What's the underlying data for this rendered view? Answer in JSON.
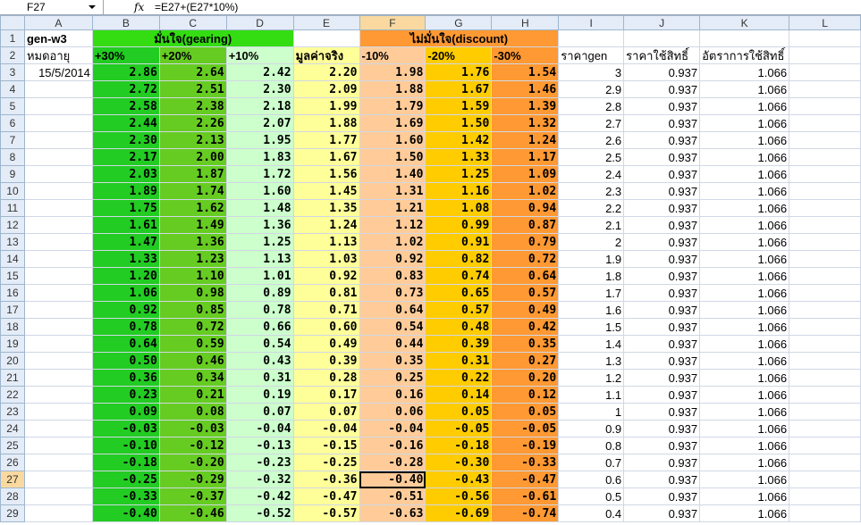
{
  "name_box": "F27",
  "formula": "=E27+(E27*10%)",
  "columns": [
    "A",
    "B",
    "C",
    "D",
    "E",
    "F",
    "G",
    "H",
    "I",
    "J",
    "K",
    "L"
  ],
  "row1": {
    "A": "gen-w3",
    "BD": "มั่นใจ(gearing)",
    "FH": "ไม่มั่นใจ(discount)"
  },
  "row2": {
    "A": "หมดอายุ",
    "B": "+30%",
    "C": "+20%",
    "D": "+10%",
    "E": "มูลค่าจริง",
    "F": "-10%",
    "G": "-20%",
    "H": "-30%",
    "I": "ราคาgen",
    "J": "ราคาใช้สิทธิ์",
    "K": "อัตราการใช้สิทธิ์"
  },
  "date": "15/5/2014",
  "rows": [
    {
      "r": "3",
      "B": "2.86",
      "C": "2.64",
      "D": "2.42",
      "E": "2.20",
      "F": "1.98",
      "G": "1.76",
      "H": "1.54",
      "I": "3",
      "J": "0.937",
      "K": "1.066"
    },
    {
      "r": "4",
      "B": "2.72",
      "C": "2.51",
      "D": "2.30",
      "E": "2.09",
      "F": "1.88",
      "G": "1.67",
      "H": "1.46",
      "I": "2.9",
      "J": "0.937",
      "K": "1.066"
    },
    {
      "r": "5",
      "B": "2.58",
      "C": "2.38",
      "D": "2.18",
      "E": "1.99",
      "F": "1.79",
      "G": "1.59",
      "H": "1.39",
      "I": "2.8",
      "J": "0.937",
      "K": "1.066"
    },
    {
      "r": "6",
      "B": "2.44",
      "C": "2.26",
      "D": "2.07",
      "E": "1.88",
      "F": "1.69",
      "G": "1.50",
      "H": "1.32",
      "I": "2.7",
      "J": "0.937",
      "K": "1.066"
    },
    {
      "r": "7",
      "B": "2.30",
      "C": "2.13",
      "D": "1.95",
      "E": "1.77",
      "F": "1.60",
      "G": "1.42",
      "H": "1.24",
      "I": "2.6",
      "J": "0.937",
      "K": "1.066"
    },
    {
      "r": "8",
      "B": "2.17",
      "C": "2.00",
      "D": "1.83",
      "E": "1.67",
      "F": "1.50",
      "G": "1.33",
      "H": "1.17",
      "I": "2.5",
      "J": "0.937",
      "K": "1.066"
    },
    {
      "r": "9",
      "B": "2.03",
      "C": "1.87",
      "D": "1.72",
      "E": "1.56",
      "F": "1.40",
      "G": "1.25",
      "H": "1.09",
      "I": "2.4",
      "J": "0.937",
      "K": "1.066"
    },
    {
      "r": "10",
      "B": "1.89",
      "C": "1.74",
      "D": "1.60",
      "E": "1.45",
      "F": "1.31",
      "G": "1.16",
      "H": "1.02",
      "I": "2.3",
      "J": "0.937",
      "K": "1.066"
    },
    {
      "r": "11",
      "B": "1.75",
      "C": "1.62",
      "D": "1.48",
      "E": "1.35",
      "F": "1.21",
      "G": "1.08",
      "H": "0.94",
      "I": "2.2",
      "J": "0.937",
      "K": "1.066"
    },
    {
      "r": "12",
      "B": "1.61",
      "C": "1.49",
      "D": "1.36",
      "E": "1.24",
      "F": "1.12",
      "G": "0.99",
      "H": "0.87",
      "I": "2.1",
      "J": "0.937",
      "K": "1.066"
    },
    {
      "r": "13",
      "B": "1.47",
      "C": "1.36",
      "D": "1.25",
      "E": "1.13",
      "F": "1.02",
      "G": "0.91",
      "H": "0.79",
      "I": "2",
      "J": "0.937",
      "K": "1.066"
    },
    {
      "r": "14",
      "B": "1.33",
      "C": "1.23",
      "D": "1.13",
      "E": "1.03",
      "F": "0.92",
      "G": "0.82",
      "H": "0.72",
      "I": "1.9",
      "J": "0.937",
      "K": "1.066"
    },
    {
      "r": "15",
      "B": "1.20",
      "C": "1.10",
      "D": "1.01",
      "E": "0.92",
      "F": "0.83",
      "G": "0.74",
      "H": "0.64",
      "I": "1.8",
      "J": "0.937",
      "K": "1.066"
    },
    {
      "r": "16",
      "B": "1.06",
      "C": "0.98",
      "D": "0.89",
      "E": "0.81",
      "F": "0.73",
      "G": "0.65",
      "H": "0.57",
      "I": "1.7",
      "J": "0.937",
      "K": "1.066"
    },
    {
      "r": "17",
      "B": "0.92",
      "C": "0.85",
      "D": "0.78",
      "E": "0.71",
      "F": "0.64",
      "G": "0.57",
      "H": "0.49",
      "I": "1.6",
      "J": "0.937",
      "K": "1.066"
    },
    {
      "r": "18",
      "B": "0.78",
      "C": "0.72",
      "D": "0.66",
      "E": "0.60",
      "F": "0.54",
      "G": "0.48",
      "H": "0.42",
      "I": "1.5",
      "J": "0.937",
      "K": "1.066"
    },
    {
      "r": "19",
      "B": "0.64",
      "C": "0.59",
      "D": "0.54",
      "E": "0.49",
      "F": "0.44",
      "G": "0.39",
      "H": "0.35",
      "I": "1.4",
      "J": "0.937",
      "K": "1.066"
    },
    {
      "r": "20",
      "B": "0.50",
      "C": "0.46",
      "D": "0.43",
      "E": "0.39",
      "F": "0.35",
      "G": "0.31",
      "H": "0.27",
      "I": "1.3",
      "J": "0.937",
      "K": "1.066"
    },
    {
      "r": "21",
      "B": "0.36",
      "C": "0.34",
      "D": "0.31",
      "E": "0.28",
      "F": "0.25",
      "G": "0.22",
      "H": "0.20",
      "I": "1.2",
      "J": "0.937",
      "K": "1.066"
    },
    {
      "r": "22",
      "B": "0.23",
      "C": "0.21",
      "D": "0.19",
      "E": "0.17",
      "F": "0.16",
      "G": "0.14",
      "H": "0.12",
      "I": "1.1",
      "J": "0.937",
      "K": "1.066"
    },
    {
      "r": "23",
      "B": "0.09",
      "C": "0.08",
      "D": "0.07",
      "E": "0.07",
      "F": "0.06",
      "G": "0.05",
      "H": "0.05",
      "I": "1",
      "J": "0.937",
      "K": "1.066"
    },
    {
      "r": "24",
      "B": "-0.03",
      "C": "-0.03",
      "D": "-0.04",
      "E": "-0.04",
      "F": "-0.04",
      "G": "-0.05",
      "H": "-0.05",
      "I": "0.9",
      "J": "0.937",
      "K": "1.066"
    },
    {
      "r": "25",
      "B": "-0.10",
      "C": "-0.12",
      "D": "-0.13",
      "E": "-0.15",
      "F": "-0.16",
      "G": "-0.18",
      "H": "-0.19",
      "I": "0.8",
      "J": "0.937",
      "K": "1.066"
    },
    {
      "r": "26",
      "B": "-0.18",
      "C": "-0.20",
      "D": "-0.23",
      "E": "-0.25",
      "F": "-0.28",
      "G": "-0.30",
      "H": "-0.33",
      "I": "0.7",
      "J": "0.937",
      "K": "1.066"
    },
    {
      "r": "27",
      "B": "-0.25",
      "C": "-0.29",
      "D": "-0.32",
      "E": "-0.36",
      "F": "-0.40",
      "G": "-0.43",
      "H": "-0.47",
      "I": "0.6",
      "J": "0.937",
      "K": "1.066"
    },
    {
      "r": "28",
      "B": "-0.33",
      "C": "-0.37",
      "D": "-0.42",
      "E": "-0.47",
      "F": "-0.51",
      "G": "-0.56",
      "H": "-0.61",
      "I": "0.5",
      "J": "0.937",
      "K": "1.066"
    },
    {
      "r": "29",
      "B": "-0.40",
      "C": "-0.46",
      "D": "-0.52",
      "E": "-0.57",
      "F": "-0.63",
      "G": "-0.69",
      "H": "-0.74",
      "I": "0.4",
      "J": "0.937",
      "K": "1.066"
    }
  ]
}
